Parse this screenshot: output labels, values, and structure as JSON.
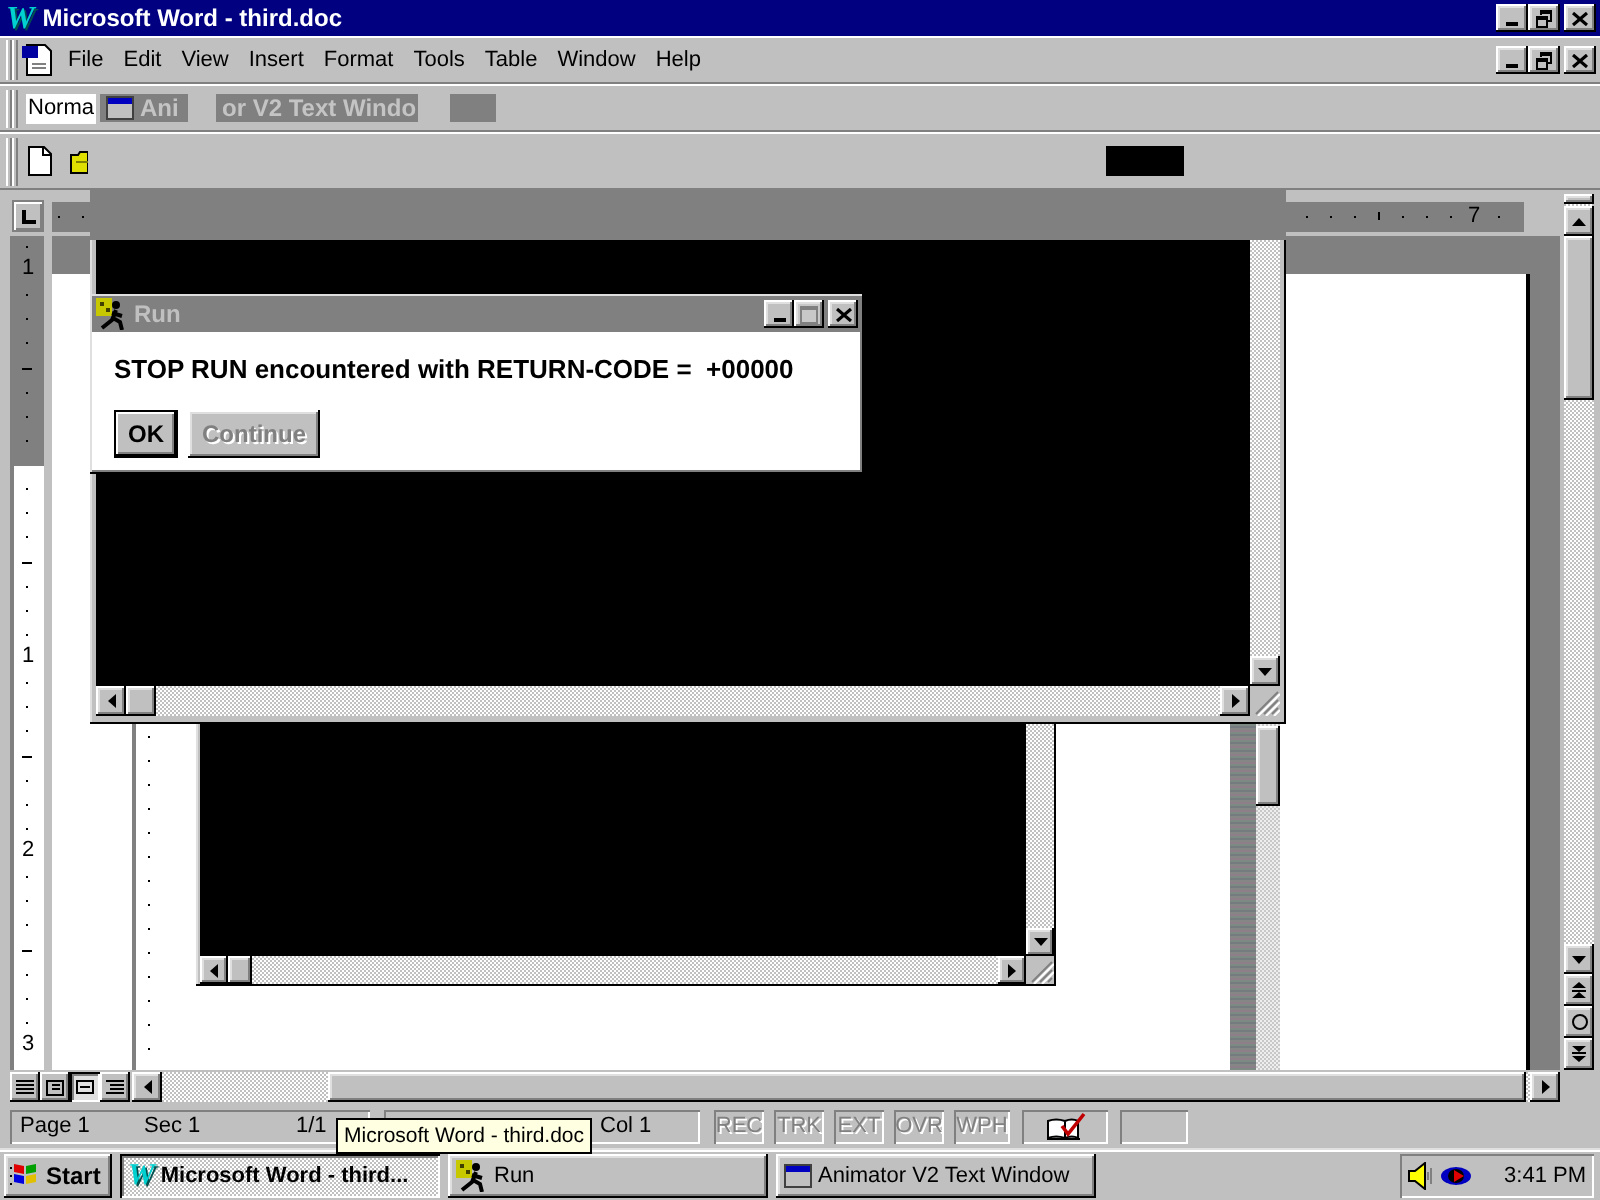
{
  "window": {
    "title": "Microsoft Word - third.doc",
    "icon_letter": "W"
  },
  "menu_bar": {
    "items": [
      "File",
      "Edit",
      "View",
      "Insert",
      "Format",
      "Tools",
      "Table",
      "Window",
      "Help"
    ]
  },
  "formatting_toolbar": {
    "style": "Norma",
    "ghost_fragments": [
      "Ani",
      "or V2 Text Windo"
    ]
  },
  "ruler": {
    "labels": [
      "7"
    ]
  },
  "vertical_ruler": {
    "labels": [
      "1",
      "1",
      "2",
      "3"
    ]
  },
  "run_dialog": {
    "title": "Run",
    "active": false,
    "controls": [
      {
        "kind": "minimize",
        "disabled": false
      },
      {
        "kind": "maximize",
        "disabled": true
      },
      {
        "kind": "close",
        "disabled": false
      }
    ],
    "message": "STOP RUN encountered with RETURN-CODE =  +00000",
    "buttons": [
      {
        "label": "OK",
        "default": true,
        "disabled": false
      },
      {
        "label": "Continue",
        "default": false,
        "disabled": true
      }
    ]
  },
  "view_buttons": [
    {
      "kind": "normal",
      "selected": false
    },
    {
      "kind": "online",
      "selected": false
    },
    {
      "kind": "page",
      "selected": true
    },
    {
      "kind": "outline",
      "selected": false
    }
  ],
  "status_bar": {
    "page": "Page 1",
    "section": "Sec 1",
    "pages": "1/1",
    "column": "Col 1",
    "indicators": [
      {
        "label": "REC",
        "disabled": true
      },
      {
        "label": "TRK",
        "disabled": true
      },
      {
        "label": "EXT",
        "disabled": true
      },
      {
        "label": "OVR",
        "disabled": true
      },
      {
        "label": "WPH",
        "disabled": true
      }
    ]
  },
  "tooltip": {
    "text": "Microsoft Word - third.doc"
  },
  "taskbar": {
    "start": "Start",
    "tasks": [
      {
        "kind": "word",
        "icon_letter": "W",
        "label": "Microsoft Word - third...",
        "selected": true
      },
      {
        "kind": "run",
        "label": "Run",
        "selected": false
      },
      {
        "kind": "window",
        "label": "Animator V2 Text Window",
        "selected": false
      }
    ],
    "clock": "3:41 PM"
  }
}
